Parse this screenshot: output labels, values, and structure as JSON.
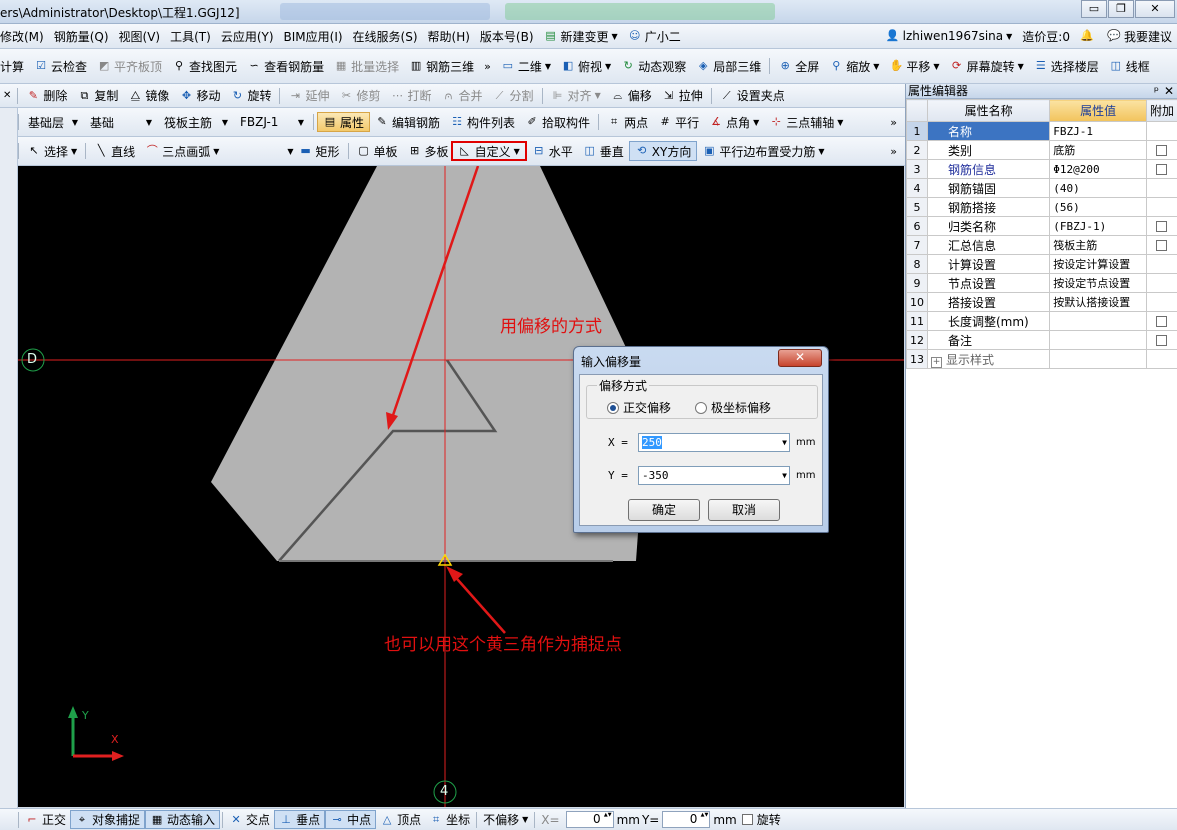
{
  "window": {
    "title": "ers\\Administrator\\Desktop\\工程1.GGJ12]",
    "min": "▭",
    "max": "❐",
    "close": "✕"
  },
  "menu": [
    "修改(M)",
    "钢筋量(Q)",
    "视图(V)",
    "工具(T)",
    "云应用(Y)",
    "BIM应用(I)",
    "在线服务(S)",
    "帮助(H)",
    "版本号(B)",
    "新建变更",
    "广小二"
  ],
  "account": {
    "user": "lzhiwen1967sina",
    "cost": "造价豆:0",
    "suggest": "我要建议"
  },
  "toolbar1": [
    "计算",
    "云检查",
    "平齐板顶",
    "查找图元",
    "查看钢筋量",
    "批量选择",
    "钢筋三维",
    "二维",
    "俯视",
    "动态观察",
    "局部三维",
    "全屏",
    "缩放",
    "平移",
    "屏幕旋转",
    "选择楼层",
    "线框"
  ],
  "toolbar2": [
    "删除",
    "复制",
    "镜像",
    "移动",
    "旋转",
    "延伸",
    "修剪",
    "打断",
    "合并",
    "分割",
    "对齐",
    "偏移",
    "拉伸",
    "设置夹点"
  ],
  "toolbar3": {
    "combo1": "基础层",
    "combo2": "基础",
    "combo3": "筏板主筋",
    "combo4": "FBZJ-1",
    "items": [
      "属性",
      "编辑钢筋",
      "构件列表",
      "拾取构件",
      "两点",
      "平行",
      "点角",
      "三点辅轴"
    ]
  },
  "toolbar4": [
    "选择",
    "直线",
    "三点画弧",
    "矩形",
    "单板",
    "多板",
    "自定义",
    "水平",
    "垂直",
    "XY方向",
    "平行边布置受力筋"
  ],
  "canvas": {
    "axis_d": "D",
    "axis_4": "4",
    "annot1": "用偏移的方式",
    "annot2": "也可以用这个黄三角作为捕捉点",
    "y": "Y",
    "x": "X"
  },
  "dialog": {
    "title": "输入偏移量",
    "close": "✕",
    "group": "偏移方式",
    "radio1": "正交偏移",
    "radio2": "极坐标偏移",
    "x_label": "X =",
    "x_value": "250",
    "y_label": "Y =",
    "y_value": "-350",
    "unit": "mm",
    "ok": "确定",
    "cancel": "取消"
  },
  "panel": {
    "title": "属性编辑器",
    "pin": "ᵖ",
    "close": "✕",
    "col_name": "属性名称",
    "col_value": "属性值",
    "col_extra": "附加",
    "rows": [
      {
        "n": "1",
        "name": "名称",
        "value": "FBZJ-1",
        "cb": false,
        "link": false
      },
      {
        "n": "2",
        "name": "类别",
        "value": "底筋",
        "cb": true,
        "link": false
      },
      {
        "n": "3",
        "name": "钢筋信息",
        "value": "Φ12@200",
        "cb": true,
        "link": true
      },
      {
        "n": "4",
        "name": "钢筋锚固",
        "value": "(40)",
        "cb": false,
        "link": false
      },
      {
        "n": "5",
        "name": "钢筋搭接",
        "value": "(56)",
        "cb": false,
        "link": false
      },
      {
        "n": "6",
        "name": "归类名称",
        "value": "(FBZJ-1)",
        "cb": true,
        "link": false
      },
      {
        "n": "7",
        "name": "汇总信息",
        "value": "筏板主筋",
        "cb": true,
        "link": false
      },
      {
        "n": "8",
        "name": "计算设置",
        "value": "按设定计算设置",
        "cb": false,
        "link": false
      },
      {
        "n": "9",
        "name": "节点设置",
        "value": "按设定节点设置",
        "cb": false,
        "link": false
      },
      {
        "n": "10",
        "name": "搭接设置",
        "value": "按默认搭接设置",
        "cb": false,
        "link": false
      },
      {
        "n": "11",
        "name": "长度调整(mm)",
        "value": "",
        "cb": true,
        "link": false
      },
      {
        "n": "12",
        "name": "备注",
        "value": "",
        "cb": true,
        "link": false
      },
      {
        "n": "13",
        "name": "显示样式",
        "value": "",
        "cb": false,
        "link": false
      }
    ]
  },
  "status": {
    "items": [
      "正交",
      "对象捕捉",
      "动态输入",
      "交点",
      "垂点",
      "中点",
      "顶点",
      "坐标",
      "不偏移"
    ],
    "x_label": "X=",
    "x_value": "0",
    "mm1": "mm",
    "y_label": "Y=",
    "y_value": "0",
    "mm2": "mm",
    "rotate": "旋转"
  }
}
